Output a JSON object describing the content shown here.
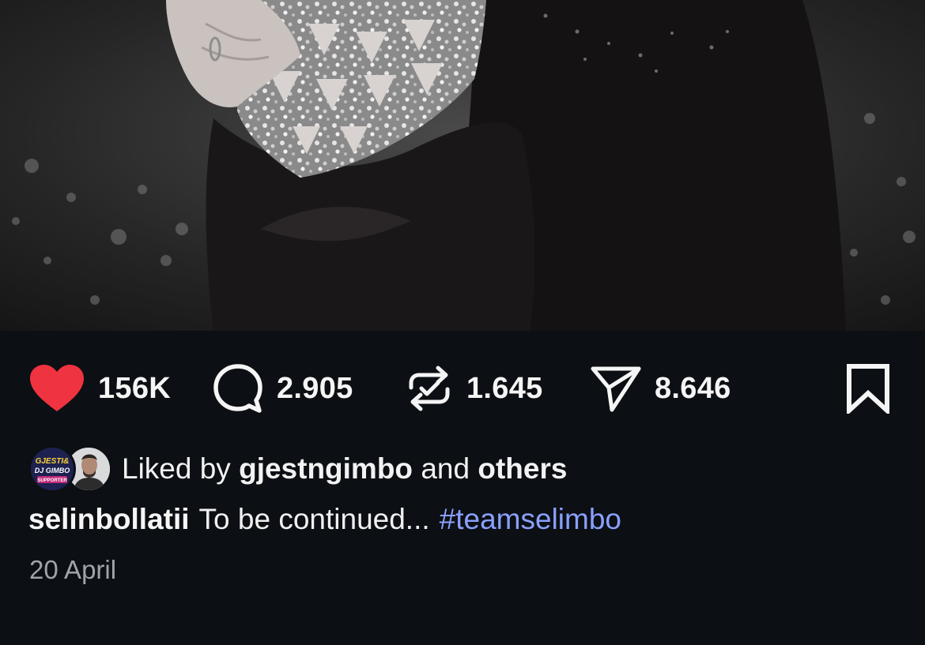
{
  "post": {
    "photo_alt": "",
    "actions": {
      "like": {
        "icon": "heart-filled-icon",
        "count": "156K",
        "liked": true,
        "color": "#ef3340"
      },
      "comment": {
        "icon": "comment-bubble-icon",
        "count": "2.905"
      },
      "repost": {
        "icon": "repost-icon",
        "count": "1.645"
      },
      "share": {
        "icon": "send-paper-plane-icon",
        "count": "8.646"
      },
      "save": {
        "icon": "bookmark-icon"
      }
    },
    "liked_by": {
      "prefix": "Liked by",
      "user": "gjestngimbo",
      "conjunction": "and",
      "suffix": "others",
      "avatar1_text": [
        "GJESTI&",
        "DJ GIMBO",
        "SUPPORTER"
      ]
    },
    "caption": {
      "username": "selinbollatii",
      "text": "To be continued...",
      "hashtag": "#teamselimbo",
      "hashtag_color": "#8aa0ff"
    },
    "date": "20 April"
  }
}
